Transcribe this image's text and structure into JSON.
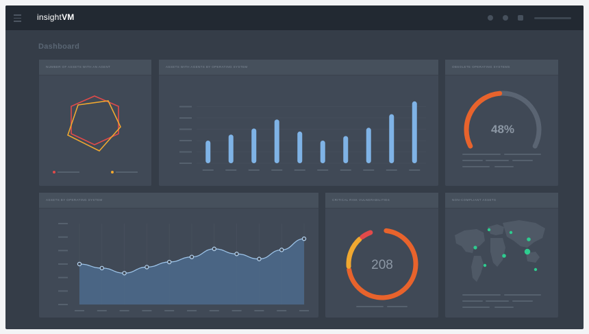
{
  "app": {
    "brand_light": "insight",
    "brand_bold": "VM"
  },
  "page": {
    "title": "Dashboard"
  },
  "topbar": {
    "icons": [
      "search-icon",
      "gear-icon",
      "user-icon"
    ]
  },
  "cards": {
    "radar": {
      "title": "Number of assets with an agent",
      "colors": [
        "#e24a4a",
        "#f0a830"
      ]
    },
    "bars": {
      "title": "Assets with agents by operating system",
      "chart_data": {
        "type": "bar",
        "categories": [
          "",
          "",
          "",
          "",
          "",
          "",
          "",
          "",
          "",
          ""
        ],
        "values": [
          30,
          38,
          46,
          58,
          42,
          30,
          36,
          47,
          65,
          82
        ],
        "ylim": [
          0,
          90
        ],
        "grid": true,
        "color": "#7fb3e6"
      }
    },
    "gauge": {
      "title": "Obsolete operating systems",
      "value_label": "48%",
      "value": 48,
      "colors": {
        "fill": "#e8632c",
        "track": "#5a6472"
      }
    },
    "area": {
      "title": "Assets by operating system",
      "chart_data": {
        "type": "area",
        "x": [
          1,
          2,
          3,
          4,
          5,
          6,
          7,
          8,
          9,
          10,
          11
        ],
        "values": [
          40,
          36,
          31,
          37,
          42,
          47,
          55,
          50,
          45,
          54,
          65
        ],
        "ylim": [
          0,
          80
        ],
        "grid": true,
        "color": "#7ea8d4"
      }
    },
    "donut": {
      "title": "Critical risk vulnerabilities",
      "value_label": "208",
      "segments": [
        {
          "color": "#e8632c",
          "fraction": 0.72
        },
        {
          "color": "#f0a830",
          "fraction": 0.16
        },
        {
          "color": "#e24a4a",
          "fraction": 0.06
        }
      ]
    },
    "map": {
      "title": "Non-compliant assets",
      "dot_color": "#2ecc8f"
    }
  }
}
